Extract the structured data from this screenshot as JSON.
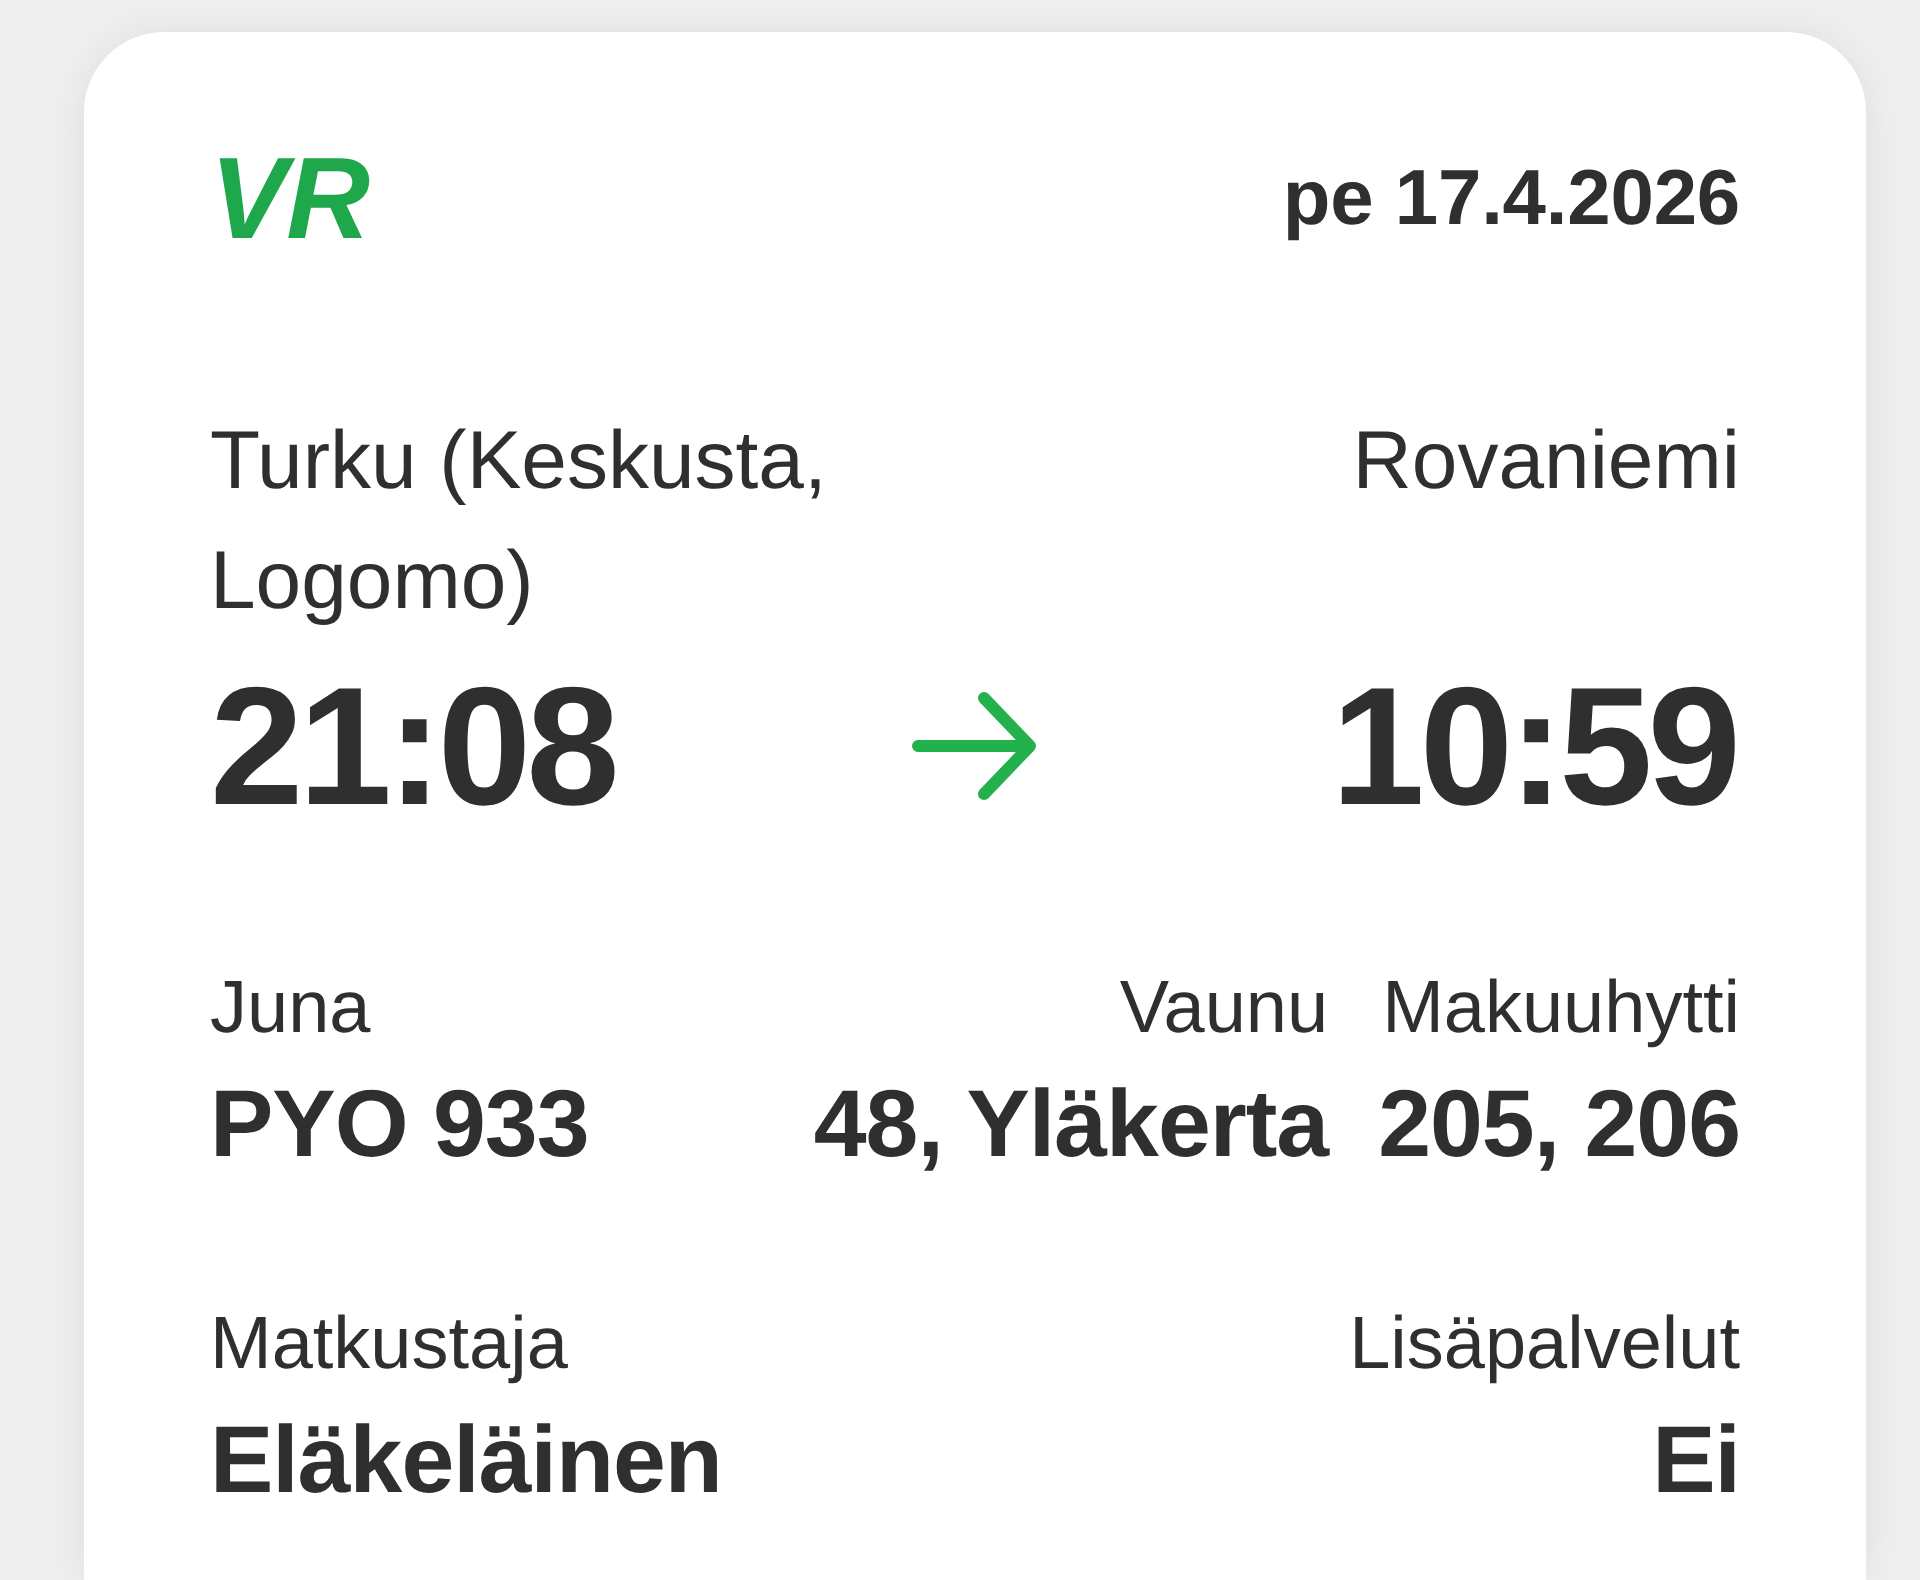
{
  "logo": "VR",
  "date": "pe 17.4.2026",
  "journey": {
    "departure": {
      "station": "Turku (Keskusta, Logomo)",
      "time": "21:08"
    },
    "arrival": {
      "station": "Rovaniemi",
      "time": "10:59"
    }
  },
  "details": [
    [
      {
        "label": "Juna",
        "value": "PYO 933"
      },
      {
        "label": "Vaunu",
        "value": "48, Yläkerta"
      },
      {
        "label": "Makuuhytti",
        "value": "205, 206"
      }
    ],
    [
      {
        "label": "Matkustaja",
        "value": "Eläkeläinen"
      },
      {
        "label": "Lisäpalvelut",
        "value": "Ei"
      }
    ]
  ]
}
